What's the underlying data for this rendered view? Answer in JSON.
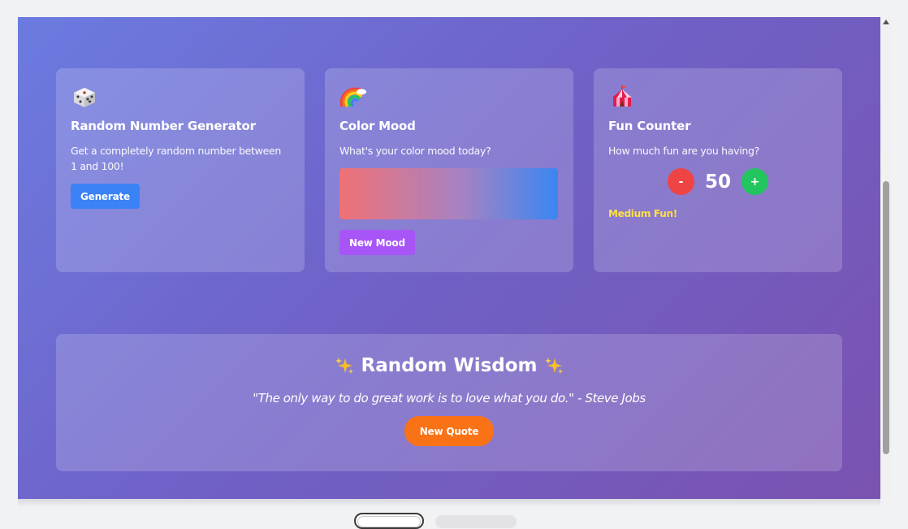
{
  "cards": [
    {
      "icon": "dice-icon",
      "title": "Random Number Generator",
      "description": "Get a completely random number between 1 and 100!",
      "button_label": "Generate"
    },
    {
      "icon": "rainbow-icon",
      "title": "Color Mood",
      "description": "What's your color mood today?",
      "button_label": "New Mood",
      "swatch_colors": [
        "#f07175",
        "#a882c2",
        "#3a86f2"
      ]
    },
    {
      "icon": "circus-tent-icon",
      "title": "Fun Counter",
      "description": "How much fun are you having?",
      "decrement_label": "-",
      "increment_label": "+",
      "counter_value": "50",
      "level_text": "Medium Fun!"
    }
  ],
  "wisdom": {
    "title": "Random Wisdom",
    "icon": "sparkles-icon",
    "quote": "\"The only way to do great work is to love what you do.\" - Steve Jobs",
    "button_label": "New Quote"
  },
  "colors": {
    "generate_button": "#3b82f6",
    "mood_button": "#a855f7",
    "minus_button": "#ef4444",
    "plus_button": "#22c55e",
    "quote_button": "#f97316",
    "fun_level_text": "#fde047"
  }
}
